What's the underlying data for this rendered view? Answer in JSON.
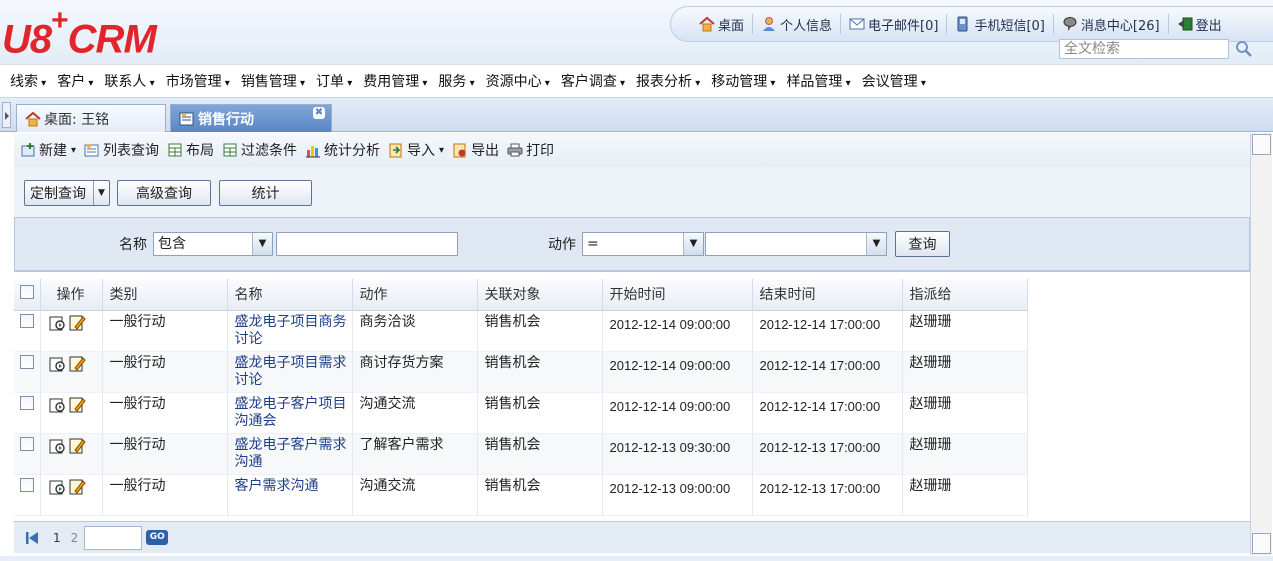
{
  "logo": {
    "prefix": "U8",
    "plus": "+",
    "name": "CRM"
  },
  "topbar": [
    {
      "icon": "home-icon",
      "label": "桌面"
    },
    {
      "icon": "user-icon",
      "label": "个人信息"
    },
    {
      "icon": "mail-icon",
      "label": "电子邮件[0]"
    },
    {
      "icon": "phone-icon",
      "label": "手机短信[0]"
    },
    {
      "icon": "message-center-icon",
      "label": "消息中心[26]"
    },
    {
      "icon": "logout-icon",
      "label": "登出"
    }
  ],
  "search": {
    "placeholder": "全文检索"
  },
  "menu": [
    "线索",
    "客户",
    "联系人",
    "市场管理",
    "销售管理",
    "订单",
    "费用管理",
    "服务",
    "资源中心",
    "客户调查",
    "报表分析",
    "移动管理",
    "样品管理",
    "会议管理"
  ],
  "tabs": {
    "home": "桌面: 王铭",
    "active": "销售行动",
    "close": "✖"
  },
  "toolbar": {
    "new": "新建",
    "list_query": "列表查询",
    "layout": "布局",
    "filter": "过滤条件",
    "stats": "统计分析",
    "import": "导入",
    "export": "导出",
    "print": "打印"
  },
  "query_buttons": {
    "custom": "定制查询",
    "advanced": "高级查询",
    "stats": "统计"
  },
  "filter": {
    "name_label": "名称",
    "name_op": "包含",
    "name_value": "",
    "action_label": "动作",
    "action_op": "=",
    "action_value": "",
    "query": "查询"
  },
  "table": {
    "columns": [
      "操作",
      "类别",
      "名称",
      "动作",
      "关联对象",
      "开始时间",
      "结束时间",
      "指派给"
    ],
    "rows": [
      {
        "type": "一般行动",
        "name": "盛龙电子项目商务讨论",
        "action": "商务洽谈",
        "related": "销售机会",
        "start": "2012-12-14 09:00:00",
        "end": "2012-12-14 17:00:00",
        "assignee": "赵珊珊"
      },
      {
        "type": "一般行动",
        "name": "盛龙电子项目需求讨论",
        "action": "商讨存货方案",
        "related": "销售机会",
        "start": "2012-12-14 09:00:00",
        "end": "2012-12-14 17:00:00",
        "assignee": "赵珊珊"
      },
      {
        "type": "一般行动",
        "name": "盛龙电子客户项目沟通会",
        "action": "沟通交流",
        "related": "销售机会",
        "start": "2012-12-14 09:00:00",
        "end": "2012-12-14 17:00:00",
        "assignee": "赵珊珊"
      },
      {
        "type": "一般行动",
        "name": "盛龙电子客户需求沟通",
        "action": "了解客户需求",
        "related": "销售机会",
        "start": "2012-12-13 09:30:00",
        "end": "2012-12-13 17:00:00",
        "assignee": "赵珊珊"
      },
      {
        "type": "一般行动",
        "name": "客户需求沟通",
        "action": "沟通交流",
        "related": "销售机会",
        "start": "2012-12-13 09:00:00",
        "end": "2012-12-13 17:00:00",
        "assignee": "赵珊珊"
      }
    ]
  },
  "pager": {
    "page1": "1",
    "page2": "2",
    "go": "GO"
  }
}
